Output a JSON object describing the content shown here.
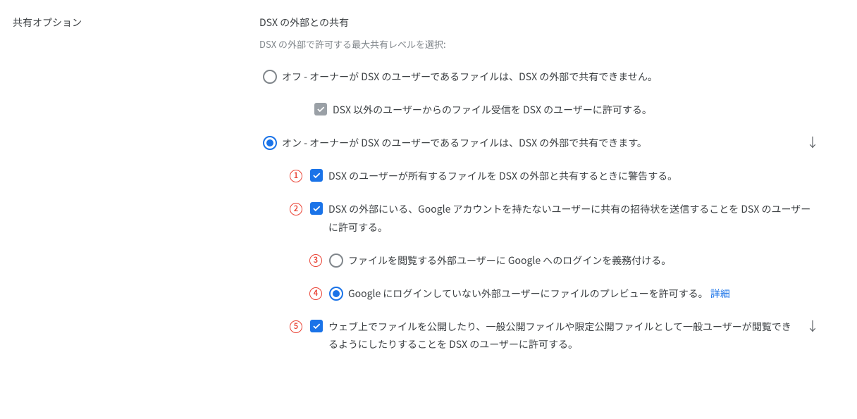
{
  "left": {
    "title": "共有オプション"
  },
  "section": {
    "title": "DSX の外部との共有",
    "subtitle": "DSX の外部で許可する最大共有レベルを選択:"
  },
  "optionOff": {
    "label": "オフ - オーナーが DSX のユーザーであるファイルは、DSX の外部で共有できません。",
    "sub": {
      "label": "DSX 以外のユーザーからのファイル受信を DSX のユーザーに許可する。"
    }
  },
  "optionOn": {
    "label": "オン - オーナーが DSX のユーザーであるファイルは、DSX の外部で共有できます。",
    "children": [
      {
        "badge": "1",
        "label": "DSX のユーザーが所有するファイルを DSX の外部と共有するときに警告する。"
      },
      {
        "badge": "2",
        "label": "DSX の外部にいる、Google アカウントを持たないユーザーに共有の招待状を送信することを DSX のユーザーに許可する。",
        "sub": [
          {
            "badge": "3",
            "label": "ファイルを閲覧する外部ユーザーに Google へのログインを義務付ける。"
          },
          {
            "badge": "4",
            "label": "Google にログインしていない外部ユーザーにファイルのプレビューを許可する。 ",
            "link": "詳細"
          }
        ]
      },
      {
        "badge": "5",
        "label": "ウェブ上でファイルを公開したり、一般公開ファイルや限定公開ファイルとして一般ユーザーが閲覧できるようにしたりすることを DSX のユーザーに許可する。"
      }
    ]
  }
}
